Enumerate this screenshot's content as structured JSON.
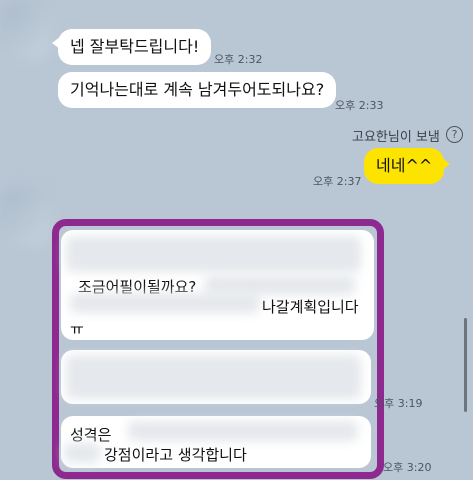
{
  "messages": {
    "m1": {
      "text": "넵 잘부탁드립니다!",
      "time": "오후 2:32"
    },
    "m2": {
      "text": "기억나는대로 계속 남겨두어도되나요?",
      "time": "오후 2:33"
    },
    "sender_note": "고요한님이 보냄",
    "help_icon": "?",
    "m3": {
      "text": "네네^^",
      "time": "오후 2:37"
    }
  },
  "highlighted": {
    "line1": "조금어필이될까요?",
    "line2": "나갈계획입니다",
    "line3": "ㅠ",
    "time1": "오후 3:19",
    "line4": "성격은",
    "line5": "강점이라고 생각합니다",
    "time2": "오후 3:20"
  },
  "colors": {
    "background": "#b9c6d4",
    "highlight": "#8e2a8f",
    "my_bubble": "#fde400"
  }
}
